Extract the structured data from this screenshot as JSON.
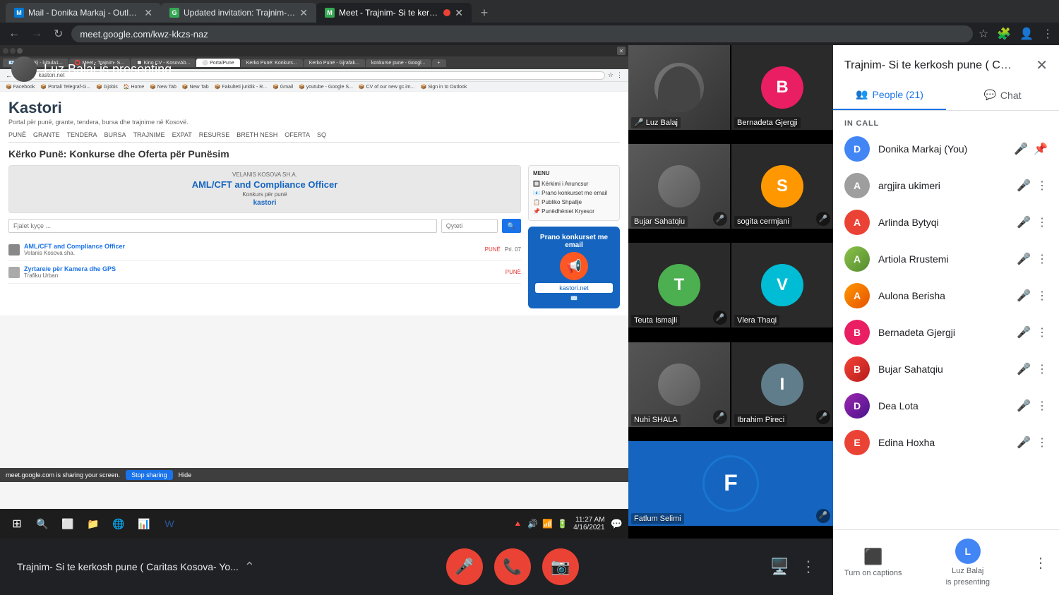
{
  "browser": {
    "tabs": [
      {
        "id": "tab1",
        "title": "Mail - Donika Markaj - Outlook",
        "favicon_color": "#0078d4",
        "favicon_letter": "M",
        "active": false
      },
      {
        "id": "tab2",
        "title": "Updated invitation: Trajnim- Si te...",
        "favicon_color": "#34a853",
        "favicon_letter": "G",
        "active": false
      },
      {
        "id": "tab3",
        "title": "Meet - Trajnim- Si te kerkosh...",
        "favicon_color": "#34a853",
        "favicon_letter": "M",
        "active": true
      }
    ],
    "url": "meet.google.com/kwz-kkzs-naz",
    "title": "Meet - Trajnim- Si te kerkosh..."
  },
  "presenter": {
    "name": "Luz Balaj",
    "label": "Luz Balaj is presenting",
    "avatar_letter": "L",
    "avatar_color": "#4285f4"
  },
  "participants_grid": [
    {
      "name": "Luz Balaj",
      "type": "video",
      "muted": false,
      "bg": "#555",
      "letter": "L",
      "color": "#4285f4"
    },
    {
      "name": "Bernadeta Gjergji",
      "type": "avatar",
      "muted": false,
      "bg": "#fff",
      "letter": "B",
      "color": "#e91e63"
    },
    {
      "name": "Bujar Sahatqiu",
      "type": "video",
      "muted": true,
      "bg": "#666",
      "letter": "B",
      "color": "#f44336"
    },
    {
      "name": "sogita cermjani",
      "type": "avatar",
      "muted": true,
      "bg": "#fff",
      "letter": "S",
      "color": "#ff9800"
    },
    {
      "name": "Teuta Ismajli",
      "type": "avatar",
      "muted": true,
      "bg": "#fff",
      "letter": "T",
      "color": "#4caf50"
    },
    {
      "name": "Vlera Thaqi",
      "type": "avatar",
      "muted": false,
      "bg": "#fff",
      "letter": "V",
      "color": "#00bcd4"
    },
    {
      "name": "Nuhi SHALA",
      "type": "video",
      "muted": true,
      "bg": "#444",
      "letter": "N",
      "color": "#9e9e9e"
    },
    {
      "name": "Ibrahim Pireci",
      "type": "avatar",
      "muted": true,
      "bg": "#fff",
      "letter": "I",
      "color": "#607d8b"
    },
    {
      "name": "Fatlum Selimi",
      "type": "avatar",
      "muted": true,
      "bg": "#fff",
      "letter": "F",
      "color": "#1565c0"
    }
  ],
  "meeting": {
    "title": "Trajnim- Si te kerkosh pune ( Caritas Kosova- Yo...",
    "short_title": "Trajnim- Si te kerkosh pune ( Caritas Kosova- Yo..."
  },
  "controls": {
    "mic_label": "Mute microphone",
    "end_label": "Leave call",
    "camera_label": "Turn off camera"
  },
  "sidebar": {
    "title": "Trajnim- Si te kerkosh pune ( Cari...",
    "close_label": "✕",
    "tabs": [
      {
        "id": "people",
        "label": "People (21)",
        "active": true,
        "icon": "👥"
      },
      {
        "id": "chat",
        "label": "Chat",
        "active": false,
        "icon": "💬"
      }
    ],
    "in_call_label": "IN CALL",
    "participants": [
      {
        "name": "Donika Markaj (You)",
        "you": true,
        "letter": "D",
        "color": "#4285f4",
        "muted": true
      },
      {
        "name": "argjira ukimeri",
        "letter": "A",
        "color": "#9e9e9e",
        "muted": true
      },
      {
        "name": "Arlinda Bytyqi",
        "letter": "A",
        "color": "#ea4335",
        "muted": true
      },
      {
        "name": "Artiola Rrustemi",
        "letter": "A",
        "color": "#8bc34a",
        "muted": true
      },
      {
        "name": "Aulona Berisha",
        "letter": "A",
        "color": "#ff9800",
        "muted": true
      },
      {
        "name": "Bernadeta Gjergji",
        "letter": "B",
        "color": "#e91e63",
        "muted": true
      },
      {
        "name": "Bujar Sahatqiu",
        "letter": "B",
        "color": "#f44336",
        "muted": true
      },
      {
        "name": "Dea Lota",
        "letter": "D",
        "color": "#9c27b0",
        "muted": true
      },
      {
        "name": "Edina Hoxha",
        "letter": "E",
        "color": "#ea4335",
        "muted": true
      }
    ],
    "footer": {
      "captions_label": "Turn on captions",
      "captions_icon": "⬜",
      "presenting_name": "Luz Balaj",
      "presenting_label": "is presenting",
      "more_label": "⋮"
    }
  },
  "website": {
    "title": "Kastori",
    "tagline": "Portal për punë, grante, tendera, bursa dhe trajnime në Kosovë.",
    "nav_items": [
      "PUNË",
      "GRANTE",
      "TENDERA",
      "BURSA",
      "TRAJNIME",
      "EXPAT",
      "RESURSE",
      "BRETH NESH",
      "OFERTA",
      "SQ"
    ],
    "heading": "Kërko Punë: Konkurse dhe Oferta për Punësim",
    "ad_company": "VELANIS KOSOVA SH.A.",
    "ad_title": "AML/CFT and Compliance Officer",
    "ad_subtitle": "Konkurs për punë",
    "ad_brand": "kastori",
    "job1_title": "AML/CFT and Compliance Officer",
    "job1_company": "Velanis Kosova sha.",
    "job2_title": "Zyrtare/e për Kamera dhe GPS",
    "job2_company": "Trafiku Urban",
    "sharing_text": "meet.google.com is sharing your screen.",
    "stop_sharing": "Stop sharing",
    "hide": "Hide",
    "email_box_title": "Prano konkurset me email",
    "email_box_brand": "kastori.net"
  },
  "taskbar": {
    "time": "11:27 AM",
    "date": "4/16/2021",
    "apps": [
      "⊞",
      "🔍",
      "◎",
      "⬜",
      "📁",
      "🌐",
      "📊",
      "W"
    ]
  }
}
